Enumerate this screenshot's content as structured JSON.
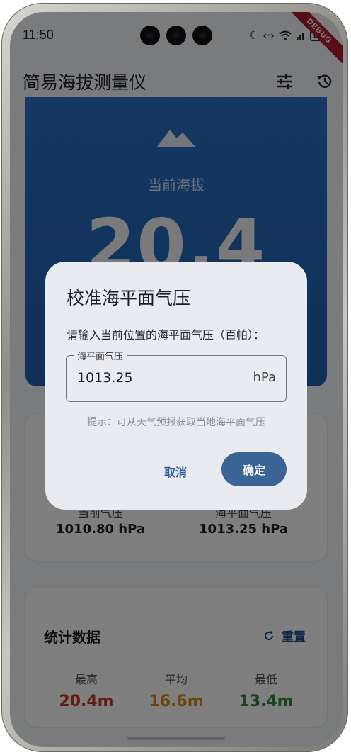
{
  "status_bar": {
    "time": "11:50",
    "battery": "100"
  },
  "debug_banner": "DEBUG",
  "app_bar": {
    "title": "简易海拔测量仪"
  },
  "altitude": {
    "label": "当前海拔",
    "value": "20.4"
  },
  "pressure": {
    "current_label": "当前气压",
    "current_value": "1010.80 hPa",
    "sea_label": "海平面气压",
    "sea_value": "1013.25 hPa"
  },
  "stats": {
    "title": "统计数据",
    "reset_label": "重置",
    "max_label": "最高",
    "max_value": "20.4m",
    "avg_label": "平均",
    "avg_value": "16.6m",
    "min_label": "最低",
    "min_value": "13.4m"
  },
  "colors": {
    "max": "#c0392b",
    "avg": "#d68910",
    "min": "#2e8b3e",
    "accent": "#3a6494"
  },
  "dialog": {
    "title": "校准海平面气压",
    "message": "请输入当前位置的海平面气压（百帕）：",
    "field_label": "海平面气压",
    "field_value": "1013.25",
    "field_suffix": "hPa",
    "hint": "提示：可从天气预报获取当地海平面气压",
    "cancel_label": "取消",
    "confirm_label": "确定"
  }
}
